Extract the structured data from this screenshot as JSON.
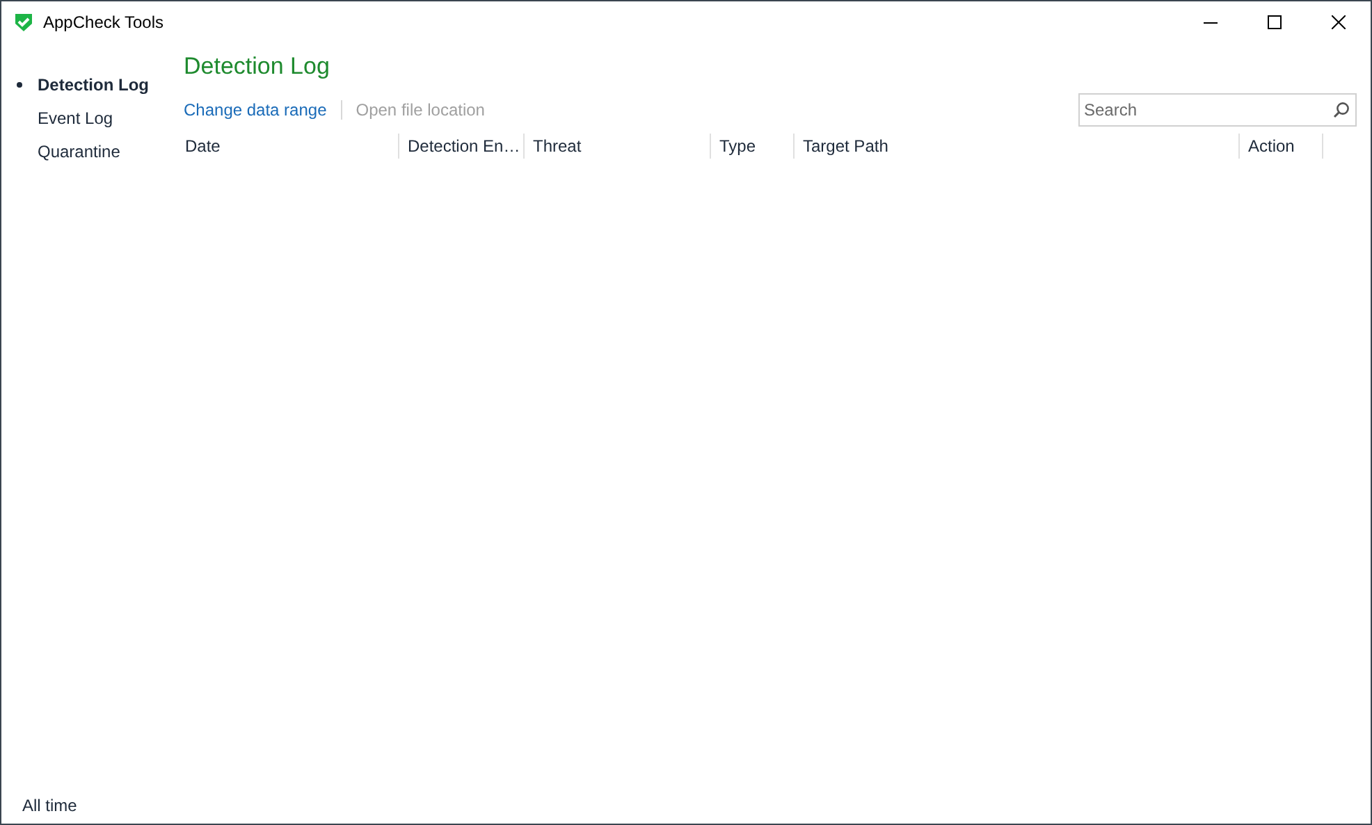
{
  "window": {
    "title": "AppCheck Tools"
  },
  "sidebar": {
    "items": [
      {
        "label": "Detection Log",
        "selected": true
      },
      {
        "label": "Event Log",
        "selected": false
      },
      {
        "label": "Quarantine",
        "selected": false
      }
    ]
  },
  "page": {
    "title": "Detection Log"
  },
  "toolbar": {
    "links": [
      {
        "label": "Change data range",
        "disabled": false
      },
      {
        "label": "Open file location",
        "disabled": true
      }
    ]
  },
  "search": {
    "placeholder": "Search"
  },
  "table": {
    "columns": [
      "Date",
      "Detection En…",
      "Threat",
      "Type",
      "Target Path",
      "Action"
    ]
  },
  "status_bar": {
    "text": "All time"
  }
}
